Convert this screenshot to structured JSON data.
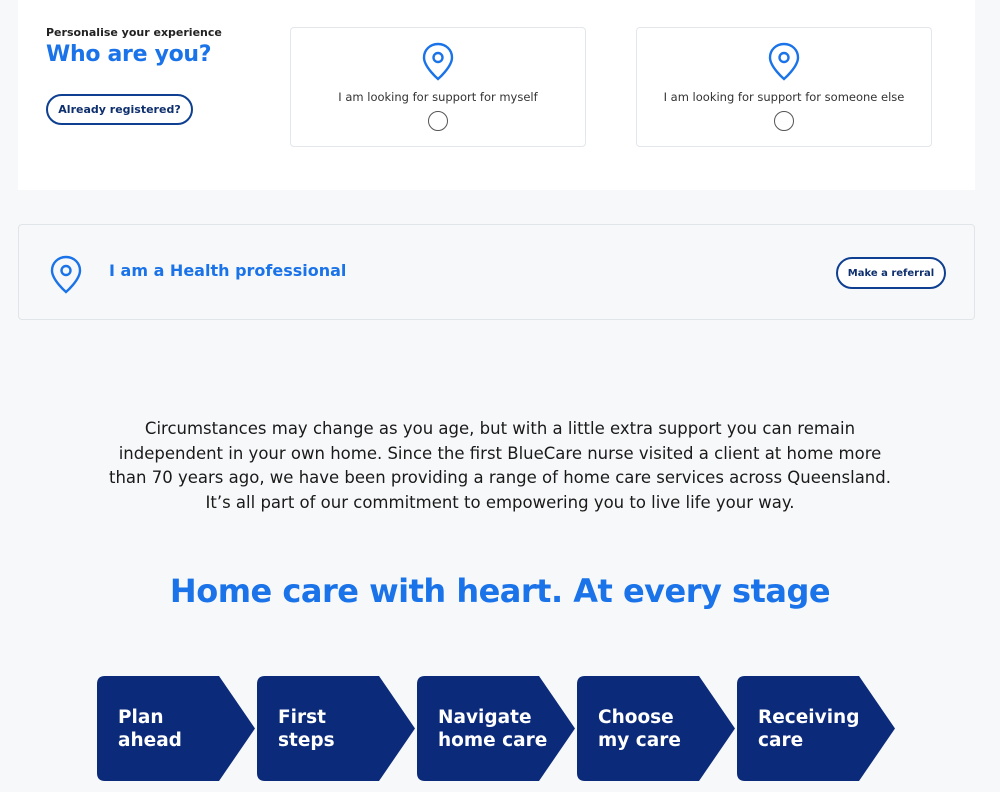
{
  "personalise": {
    "kicker": "Personalise your experience",
    "title": "Who are you?",
    "registered_button": "Already registered?",
    "options": [
      {
        "label": "I am looking for support for myself",
        "icon": "location-pin-icon"
      },
      {
        "label": "I am looking for support for someone else",
        "icon": "location-pin-icon"
      }
    ]
  },
  "health_professional": {
    "title": "I am a Health professional",
    "icon": "location-pin-icon",
    "button": "Make a referral"
  },
  "intro": {
    "paragraph": "Circumstances may change as you age, but with a little extra support you can remain independent in your own home. Since the first BlueCare nurse visited a client at home more than 70 years ago, we have been providing a range of home care services across Queensland. It’s all part of our commitment to empowering you to live life your way."
  },
  "stages_section": {
    "heading": "Home care with heart. At every stage",
    "stages": [
      {
        "label": "Plan\nahead"
      },
      {
        "label": "First\nsteps"
      },
      {
        "label": "Navigate\nhome care"
      },
      {
        "label": "Choose\nmy care"
      },
      {
        "label": "Receiving\ncare"
      }
    ]
  },
  "colors": {
    "accent": "#1a73e8",
    "navy": "#0e2f6e",
    "stage_fill": "#0b2a7a"
  }
}
